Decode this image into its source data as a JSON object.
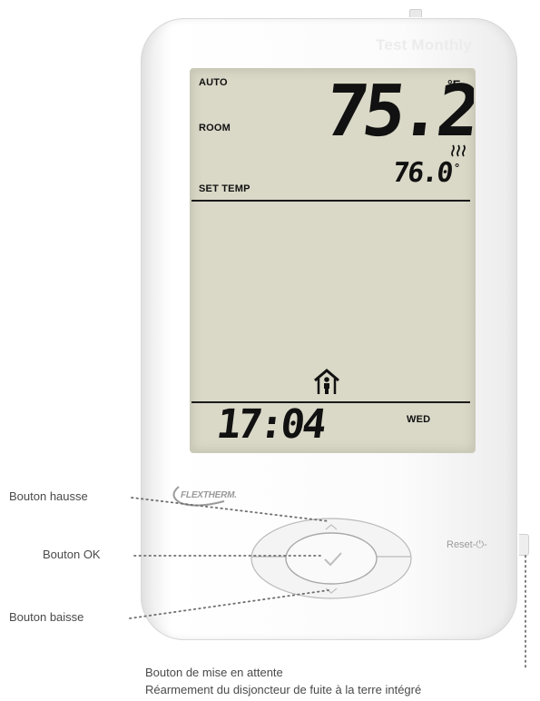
{
  "device": {
    "brand_top": "Test Monthly",
    "brand_logo": "FLEXTHERM.",
    "reset_label": "Reset-⏻-"
  },
  "lcd": {
    "mode": "AUTO",
    "room_label": "ROOM",
    "room_temp": "75.2",
    "room_unit": "°F",
    "set_label": "SET TEMP",
    "set_temp": "76.0",
    "set_unit": "°",
    "time": "17:04",
    "day": "WED",
    "icons": [
      "heating-icon",
      "home-occupied-icon"
    ]
  },
  "callouts": {
    "up": "Bouton hausse",
    "ok": "Bouton OK",
    "down": "Bouton baisse",
    "standby_line1": "Bouton de mise en attente",
    "standby_line2": "Réarmement du disjoncteur de fuite à la terre intégré"
  },
  "colors": {
    "lcd_background": "#dad8c7",
    "lcd_text": "#111111",
    "device_body": "#f7f7f7",
    "callout_text": "#4a4a4a"
  }
}
